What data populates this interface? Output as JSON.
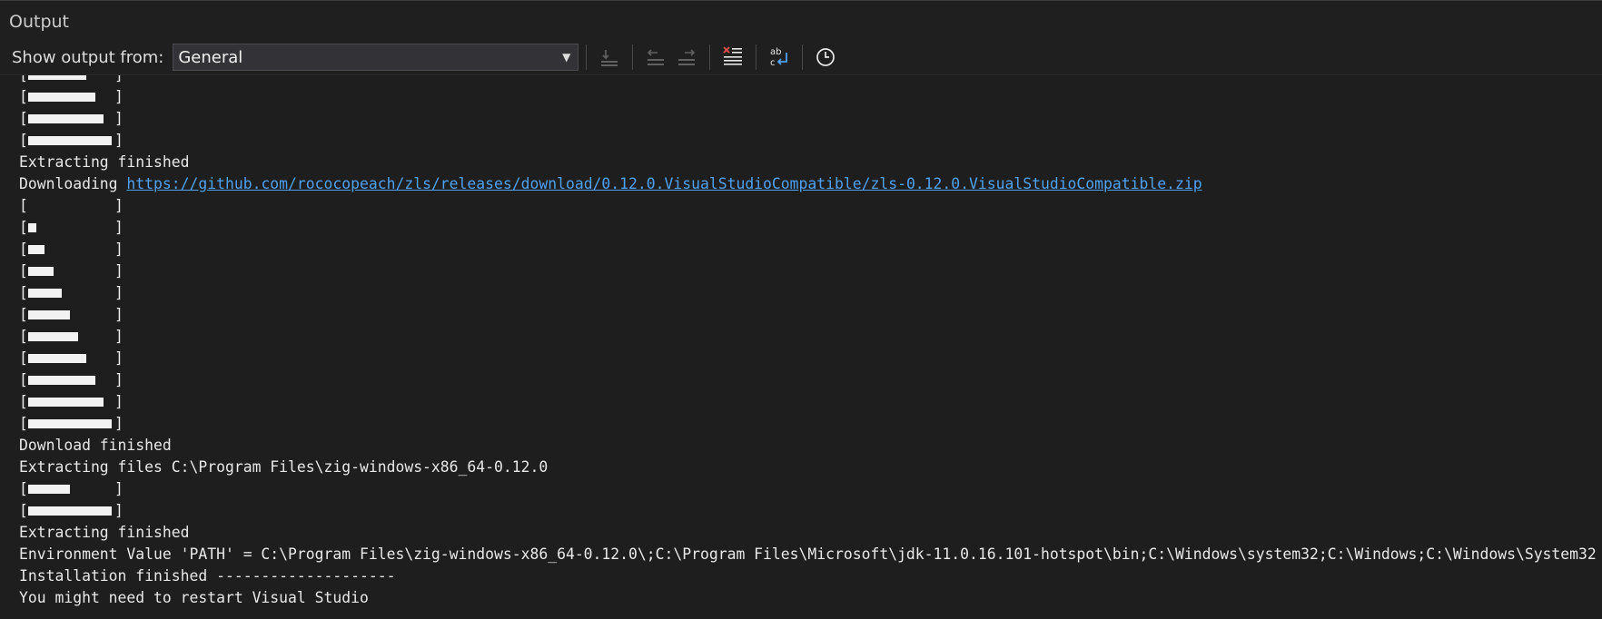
{
  "panel": {
    "title": "Output"
  },
  "toolbar": {
    "show_from_label": "Show output from:",
    "source_selected": "General",
    "buttons": [
      {
        "name": "find-message-in-code-button",
        "icon": "goto-code-icon",
        "enabled": false
      },
      {
        "name": "previous-message-button",
        "icon": "previous-message-icon",
        "enabled": false
      },
      {
        "name": "next-message-button",
        "icon": "next-message-icon",
        "enabled": false
      },
      {
        "name": "clear-all-button",
        "icon": "clear-all-icon",
        "enabled": true
      },
      {
        "name": "toggle-word-wrap-button",
        "icon": "word-wrap-icon",
        "enabled": true
      },
      {
        "name": "show-timestamps-button",
        "icon": "clock-icon",
        "enabled": true
      }
    ]
  },
  "colors": {
    "background": "#1e1e1e",
    "text": "#e8e8e8",
    "link": "#4ea1f3"
  },
  "output": {
    "lines": [
      {
        "type": "progress",
        "open": "[",
        "close": "]",
        "fill": 0.7
      },
      {
        "type": "progress",
        "open": "[",
        "close": "]",
        "fill": 0.8
      },
      {
        "type": "progress",
        "open": "[",
        "close": "]",
        "fill": 0.9
      },
      {
        "type": "progress",
        "open": "[",
        "close": "]",
        "fill": 1.0
      },
      {
        "type": "text",
        "text": "Extracting finished"
      },
      {
        "type": "link",
        "prefix": "Downloading ",
        "url": "https://github.com/rococopeach/zls/releases/download/0.12.0.VisualStudioCompatible/zls-0.12.0.VisualStudioCompatible.zip"
      },
      {
        "type": "progress",
        "open": "[",
        "close": "]",
        "fill": 0.0
      },
      {
        "type": "progress",
        "open": "[",
        "close": "]",
        "fill": 0.1
      },
      {
        "type": "progress",
        "open": "[",
        "close": "]",
        "fill": 0.2
      },
      {
        "type": "progress",
        "open": "[",
        "close": "]",
        "fill": 0.3
      },
      {
        "type": "progress",
        "open": "[",
        "close": "]",
        "fill": 0.4
      },
      {
        "type": "progress",
        "open": "[",
        "close": "]",
        "fill": 0.5
      },
      {
        "type": "progress",
        "open": "[",
        "close": "]",
        "fill": 0.6
      },
      {
        "type": "progress",
        "open": "[",
        "close": "]",
        "fill": 0.7
      },
      {
        "type": "progress",
        "open": "[",
        "close": "]",
        "fill": 0.8
      },
      {
        "type": "progress",
        "open": "[",
        "close": "]",
        "fill": 0.9
      },
      {
        "type": "progress",
        "open": "[",
        "close": "]",
        "fill": 1.0
      },
      {
        "type": "text",
        "text": "Download finished"
      },
      {
        "type": "text",
        "text": "Extracting files C:\\Program Files\\zig-windows-x86_64-0.12.0"
      },
      {
        "type": "progress",
        "open": "[",
        "close": "]",
        "fill": 0.5
      },
      {
        "type": "progress",
        "open": "[",
        "close": "]",
        "fill": 1.0
      },
      {
        "type": "text",
        "text": "Extracting finished"
      },
      {
        "type": "text",
        "text": "Environment Value 'PATH' = C:\\Program Files\\zig-windows-x86_64-0.12.0\\;C:\\Program Files\\Microsoft\\jdk-11.0.16.101-hotspot\\bin;C:\\Windows\\system32;C:\\Windows;C:\\Windows\\System32"
      },
      {
        "type": "text",
        "text": "Installation finished --------------------"
      },
      {
        "type": "text",
        "text": "You might need to restart Visual Studio"
      }
    ]
  }
}
